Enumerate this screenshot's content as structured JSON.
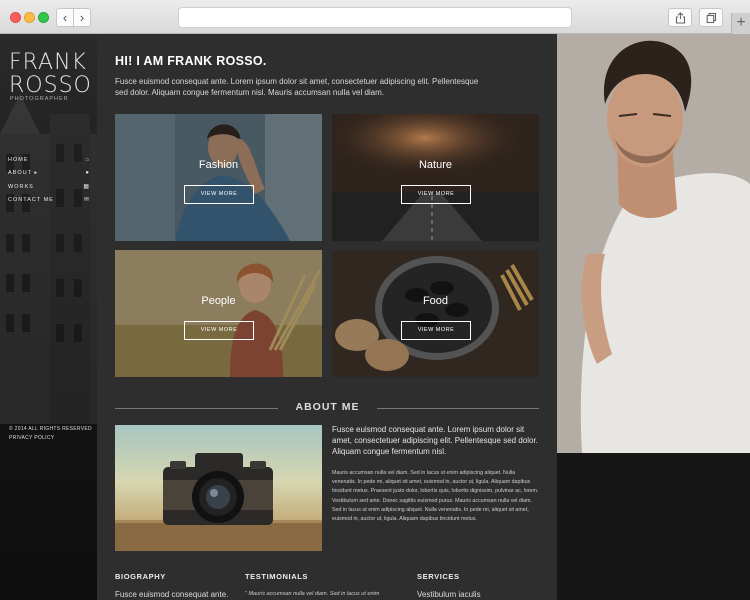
{
  "browser": {
    "back_glyph": "‹",
    "forward_glyph": "›",
    "new_tab_glyph": "+"
  },
  "sidebar": {
    "logo_line1": "FRANK",
    "logo_line2": "ROSSO",
    "subtitle": "PHOTOGRAPHER",
    "menu": [
      {
        "label": "HOME",
        "icon": "home-icon",
        "glyph": "⌂"
      },
      {
        "label": "ABOUT ▸",
        "icon": "info-icon",
        "glyph": "●"
      },
      {
        "label": "WORKS",
        "icon": "grid-icon",
        "glyph": "▦"
      },
      {
        "label": "CONTACT ME",
        "icon": "mail-icon",
        "glyph": "✉"
      }
    ],
    "copyright": "© 2014 ALL RIGHTS RESERVED",
    "privacy": "PRIVACY POLICY"
  },
  "hero": {
    "title": "HI! I AM FRANK ROSSO.",
    "text": "Fusce euismod consequat ante. Lorem ipsum dolor sit amet, consectetuer adipiscing elit. Pellentesque sed dolor. Aliquam congue fermentum nisl. Mauris accumsan nulla vel diam."
  },
  "gallery": [
    {
      "label": "Fashion",
      "button": "VIEW MORE"
    },
    {
      "label": "Nature",
      "button": "VIEW MORE"
    },
    {
      "label": "People",
      "button": "VIEW MORE"
    },
    {
      "label": "Food",
      "button": "VIEW MORE"
    }
  ],
  "about": {
    "heading": "ABOUT ME",
    "lead": "Fusce euismod consequat ante. Lorem ipsum dolor sit amet, consectetuer adipiscing elit. Pellentesque sed dolor. Aliquam congue fermentum nisl.",
    "body": "Mauris accumsan nulla vel diam. Sed in lacus ut enim adipiscing aliquet. Nulla venenatis. In pede mi, aliquet sit amet, euismod in, auctor ut, ligula. Aliquam dapibus tincidunt metus. Praesent justo dolor, lobortis quis, lobortis dignissim, pulvinar ac, lorem. Vestibulum sed ante. Donec sagittis euismod purus. Mauris accumsan nulla vel diam. Sed in lacus ut enim adipiscing aliquet. Nulla venenatis. In pede mi, aliquet sit amet, euismod in, auctor ut, ligula. Aliquam dapibus tincidunt metus."
  },
  "footer_cols": {
    "biography": {
      "heading": "BIOGRAPHY",
      "text": "Fusce euismod consequat ante."
    },
    "testimonials": {
      "heading": "TESTIMONIALS",
      "text": "\" Mauris accumsan nulla vel diam. Sed in lacus ut enim"
    },
    "services": {
      "heading": "SERVICES",
      "text": "Vestibulum iaculis"
    }
  }
}
